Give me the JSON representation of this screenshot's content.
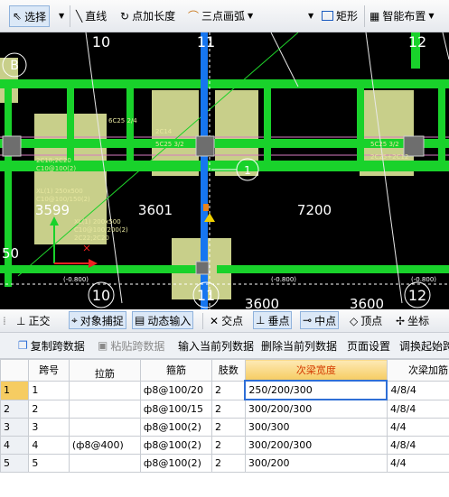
{
  "toolbar": {
    "select_label": "选择",
    "line_label": "直线",
    "point_extend_label": "点加长度",
    "three_point_arc_label": "三点画弧",
    "rect_label": "矩形",
    "smart_layout_label": "智能布置"
  },
  "canvas": {
    "grid_top": [
      "10",
      "11",
      "12"
    ],
    "grid_bottom": [
      "10",
      "11",
      "12"
    ],
    "axis_label_b": "B",
    "dims": [
      "3599",
      "3601",
      "7200",
      "3600",
      "3600"
    ],
    "left_partial": "50",
    "marker_circle": "1",
    "notes": {
      "c1": "C10@100(2)",
      "c2": "2C18;2C20",
      "c3": "C10@100/150(2)",
      "c4": "C10@100/200(2)",
      "c5": "2C22;2C20",
      "c6": "XL(1) 250x500",
      "c7": "XL(1) 200x500",
      "c8": "5C25 3/2",
      "c9": "2C14",
      "c10": "5C25 3/2",
      "c11": "2C25+2C12",
      "c12": "(-0.800)",
      "c13": "(-0.800)",
      "c14": "(-0.800)",
      "c15": "6C25 2/4"
    },
    "colors": {
      "beam_green": "#19d22b",
      "wall_yellow": "#c8cf8a",
      "axis_blue": "#1676f0"
    }
  },
  "snap": {
    "ortho": "正交",
    "object_snap": "对象捕捉",
    "dynamic_input": "动态输入",
    "intersection": "交点",
    "perpendicular": "垂点",
    "midpoint": "中点",
    "vertex": "顶点",
    "coordinate": "坐标"
  },
  "gridbar": {
    "copy": "复制跨数据",
    "paste": "粘贴跨数据",
    "input_col": "输入当前列数据",
    "delete_col": "删除当前列数据",
    "page_setup": "页面设置",
    "adjust_start": "调换起始跨"
  },
  "table": {
    "headers": [
      "跨号",
      "拉筋",
      "箍筋",
      "肢数",
      "次梁宽度",
      "次梁加筋"
    ],
    "rows": [
      {
        "n": "1",
        "span": "1",
        "tie": "",
        "stirrup": "ф8@100/20",
        "legs": "2",
        "width": "250/200/300",
        "rebar": "4/8/4"
      },
      {
        "n": "2",
        "span": "2",
        "tie": "",
        "stirrup": "ф8@100/15",
        "legs": "2",
        "width": "300/200/300",
        "rebar": "4/8/4"
      },
      {
        "n": "3",
        "span": "3",
        "tie": "",
        "stirrup": "ф8@100(2)",
        "legs": "2",
        "width": "300/300",
        "rebar": "4/4"
      },
      {
        "n": "4",
        "span": "4",
        "tie": "(ф8@400)",
        "stirrup": "ф8@100(2)",
        "legs": "2",
        "width": "300/200/300",
        "rebar": "4/8/4"
      },
      {
        "n": "5",
        "span": "5",
        "tie": "",
        "stirrup": "ф8@100(2)",
        "legs": "2",
        "width": "300/200",
        "rebar": "4/4"
      }
    ]
  }
}
